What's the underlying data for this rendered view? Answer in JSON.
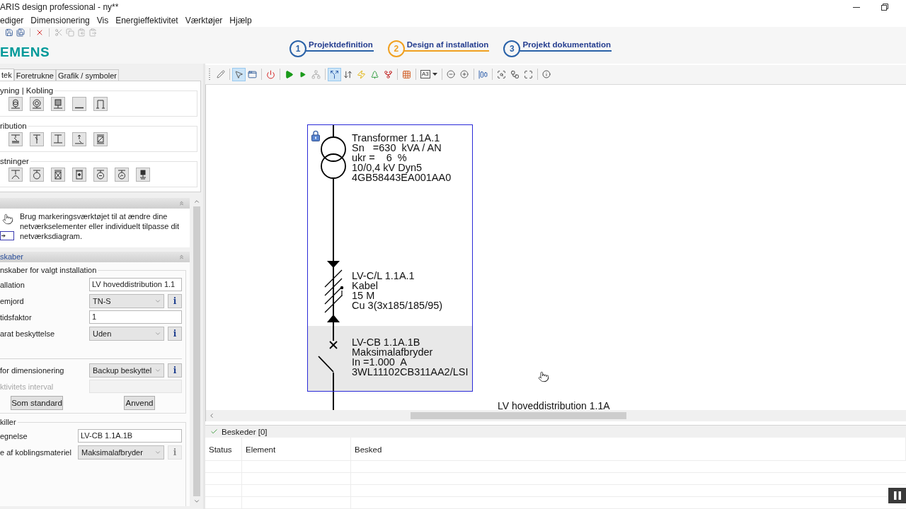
{
  "window": {
    "title": "ARIS design professional - ny**"
  },
  "menu": [
    "ediger",
    "Dimensionering",
    "Vis",
    "Energieffektivitet",
    "Værktøjer",
    "Hjælp"
  ],
  "quick_toolbar": [
    {
      "disabled": false
    },
    {
      "disabled": false
    },
    {
      "disabled": false
    },
    {
      "disabled": true
    },
    {
      "disabled": true
    },
    {
      "disabled": true
    },
    {
      "disabled": true
    }
  ],
  "logo": "EMENS",
  "steps": [
    {
      "number": "1",
      "label": "Projektdefinition",
      "selected": false
    },
    {
      "number": "2",
      "label": "Design af installation",
      "selected": true
    },
    {
      "number": "3",
      "label": "Projekt dokumentation",
      "selected": false
    }
  ],
  "library": {
    "tabs": [
      {
        "label": "tek",
        "selected": true
      },
      {
        "label": "Foretrukne",
        "selected": false
      },
      {
        "label": "Grafik / symboler",
        "selected": false
      }
    ],
    "groups": [
      {
        "title": "yning | Kobling"
      },
      {
        "title": "ribution"
      },
      {
        "title": "stninger"
      }
    ]
  },
  "hint": {
    "text": "Brug markeringsværktøjet til at ændre dine netværkselementer eller individuelt tilpasse dit netværksdiagram."
  },
  "properties": {
    "title": "skaber",
    "groups": [
      {
        "title": "nskaber for valgt installation",
        "fields": [
          {
            "label": "allation",
            "kind": "input",
            "value": "LV hoveddistribution 1.1",
            "disabled": false
          },
          {
            "label": "emjord",
            "kind": "select",
            "value": "TN-S",
            "disabled": false,
            "info": {
              "label": "i",
              "disabled": false
            }
          },
          {
            "label": "tidsfaktor",
            "kind": "input",
            "value": "1",
            "disabled": false
          },
          {
            "label": "arat beskyttelse",
            "kind": "select",
            "value": "Uden",
            "disabled": false,
            "info": {
              "label": "i",
              "disabled": false
            }
          }
        ],
        "fields_after_rule": [
          {
            "label": "for dimensionering",
            "kind": "select",
            "value": "Backup beskyttel",
            "disabled": false,
            "info": {
              "label": "i",
              "disabled": false
            }
          },
          {
            "label": "ktivitets interval",
            "kind": "input",
            "disabled": true
          }
        ],
        "buttons": [
          "Som standard",
          "Anvend"
        ]
      },
      {
        "title": "killer",
        "fields": [
          {
            "label": "egnelse",
            "kind": "input",
            "value": "LV-CB 1.1A.1B",
            "disabled": false
          },
          {
            "label": "e af koblingsmateriel",
            "kind": "select",
            "value": "Maksimalafbryder",
            "disabled": false,
            "info": {
              "label": "i",
              "disabled": true
            }
          }
        ]
      }
    ]
  },
  "canvas_toolbar": [
    {
      "selected": false,
      "disabled": false
    },
    {
      "selected": true,
      "disabled": false
    },
    {
      "selected": false,
      "disabled": false
    },
    {
      "selected": false,
      "disabled": false
    },
    {
      "selected": false,
      "disabled": false
    },
    {
      "selected": false,
      "disabled": false
    },
    {
      "selected": false,
      "disabled": true
    },
    {
      "selected": true,
      "disabled": false
    },
    {
      "selected": false,
      "disabled": false
    },
    {
      "selected": false,
      "disabled": false
    },
    {
      "selected": false,
      "disabled": false
    },
    {
      "selected": false,
      "disabled": false
    },
    {
      "selected": false,
      "disabled": false
    },
    {
      "selected": false,
      "disabled": false,
      "label": "A3"
    },
    {
      "selected": false,
      "disabled": false
    },
    {
      "selected": false,
      "disabled": false
    },
    {
      "selected": false,
      "disabled": false
    },
    {
      "selected": false,
      "disabled": false
    },
    {
      "selected": false,
      "disabled": false
    },
    {
      "selected": false,
      "disabled": false
    },
    {
      "selected": false,
      "disabled": false
    }
  ],
  "diagram": {
    "selected": true,
    "elements": [
      {
        "kind": "transformer",
        "locked": true,
        "highlighted": false,
        "lines": [
          "Transformer 1.1A.1",
          "Sn   =630  kVA / AN",
          "ukr =    6  %",
          "10/0,4 kV Dyn5",
          "4GB58443EA001AA0"
        ]
      },
      {
        "kind": "cable",
        "locked": false,
        "highlighted": false,
        "lines": [
          "LV-C/L 1.1A.1",
          "Kabel",
          "15 M",
          "Cu 3(3x185/185/95)"
        ]
      },
      {
        "kind": "breaker",
        "locked": false,
        "highlighted": true,
        "lines": [
          "LV-CB 1.1A.1B",
          "Maksimalafbryder",
          "In =1.000  A",
          "3WL11102CB311AA2/LSI"
        ]
      }
    ],
    "bus_label": "LV hoveddistribution 1.1A"
  },
  "messages": {
    "title": "Beskeder [0]",
    "columns": [
      "Status",
      "Element",
      "Besked"
    ]
  }
}
